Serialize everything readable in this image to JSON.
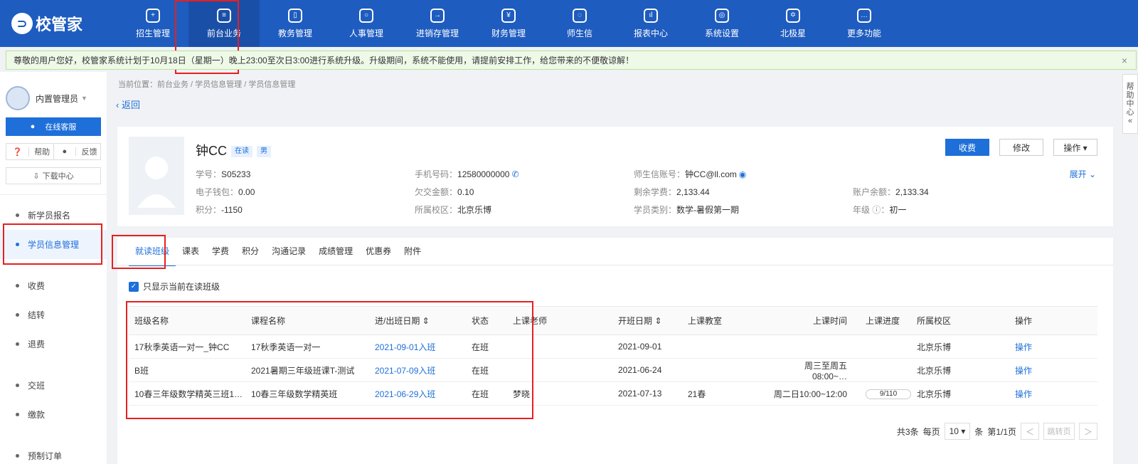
{
  "logo": {
    "text": "校管家"
  },
  "nav": [
    {
      "label": "招生管理",
      "icon": "user-add-icon"
    },
    {
      "label": "前台业务",
      "icon": "desk-icon"
    },
    {
      "label": "教务管理",
      "icon": "book-icon"
    },
    {
      "label": "人事管理",
      "icon": "person-icon"
    },
    {
      "label": "进销存管理",
      "icon": "inventory-icon"
    },
    {
      "label": "财务管理",
      "icon": "finance-icon"
    },
    {
      "label": "师生信",
      "icon": "chat-icon"
    },
    {
      "label": "报表中心",
      "icon": "chart-icon"
    },
    {
      "label": "系统设置",
      "icon": "settings-icon"
    },
    {
      "label": "北极星",
      "icon": "star-icon"
    },
    {
      "label": "更多功能",
      "icon": "more-icon"
    }
  ],
  "notice": {
    "text": "尊敬的用户您好，校管家系统计划于10月18日（星期一）晚上23:00至次日3:00进行系统升级。升级期间，系统不能使用，请提前安排工作，给您带来的不便敬谅解！",
    "close": "×"
  },
  "sidebar": {
    "user": "内置管理员",
    "online": "在线客服",
    "help": "帮助",
    "feedback": "反馈",
    "download": "下载中心",
    "menu": [
      "新学员报名",
      "学员信息管理",
      "收费",
      "结转",
      "退费",
      "交班",
      "缴款",
      "预制订单"
    ]
  },
  "breadcrumb": "当前位置：前台业务 / 学员信息管理 / 学员信息管理",
  "back": "返回",
  "student": {
    "name": "钟CC",
    "status": "在读",
    "gender": "男",
    "fields": [
      {
        "label": "学号：",
        "value": "S05233"
      },
      {
        "label": "手机号码：",
        "value": "12580000000"
      },
      {
        "label": "师生信账号：",
        "value": "钟CC@ll.com"
      },
      {
        "label": "电子钱包：",
        "value": "0.00"
      },
      {
        "label": "欠交金额：",
        "value": "0.10"
      },
      {
        "label": "剩余学费：",
        "value": "2,133.44"
      },
      {
        "label": "账户余额：",
        "value": "2,133.34"
      },
      {
        "label": "积分：",
        "value": "-1150"
      },
      {
        "label": "所属校区：",
        "value": "北京乐博"
      },
      {
        "label": "学员类别：",
        "value": "数学-暑假第一期"
      },
      {
        "label": "年级 ⓘ：",
        "value": "初一"
      }
    ],
    "buttons": {
      "charge": "收费",
      "edit": "修改",
      "ops": "操作 ▾"
    },
    "expand": "展开 ⌄"
  },
  "tabs": [
    "就读班级",
    "课表",
    "学费",
    "积分",
    "沟通记录",
    "成绩管理",
    "优惠券",
    "附件"
  ],
  "filter": "只显示当前在读班级",
  "table": {
    "headers": [
      "班级名称",
      "课程名称",
      "进/出班日期 ⇕",
      "状态",
      "上课老师",
      "开班日期 ⇕",
      "上课教室",
      "上课时间",
      "上课进度",
      "所属校区",
      "操作"
    ],
    "rows": [
      [
        "17秋季英语一对一_钟CC",
        "17秋季英语一对一",
        "2021-09-01入班",
        "在班",
        "",
        "2021-09-01",
        "",
        "",
        "",
        "北京乐博",
        "操作"
      ],
      [
        "B班",
        "2021暑期三年级班课T-测试",
        "2021-07-09入班",
        "在班",
        "",
        "2021-06-24",
        "",
        "周三至周五08:00~…",
        "",
        "北京乐博",
        "操作"
      ],
      [
        "10春三年级数学精英三班1…",
        "10春三年级数学精英班",
        "2021-06-29入班",
        "在班",
        "梦晓",
        "2021-07-13",
        "21春",
        "周二日10:00~12:00",
        "9/110",
        "北京乐博",
        "操作"
      ]
    ]
  },
  "pager": {
    "total": "共3条",
    "per": "每页",
    "size": "10 ▾",
    "unit": "条",
    "page": "第1/1页",
    "prev": "＜",
    "jump": "跳转页",
    "next": "＞"
  },
  "helpside": [
    "帮",
    "助",
    "中",
    "心",
    "«"
  ]
}
